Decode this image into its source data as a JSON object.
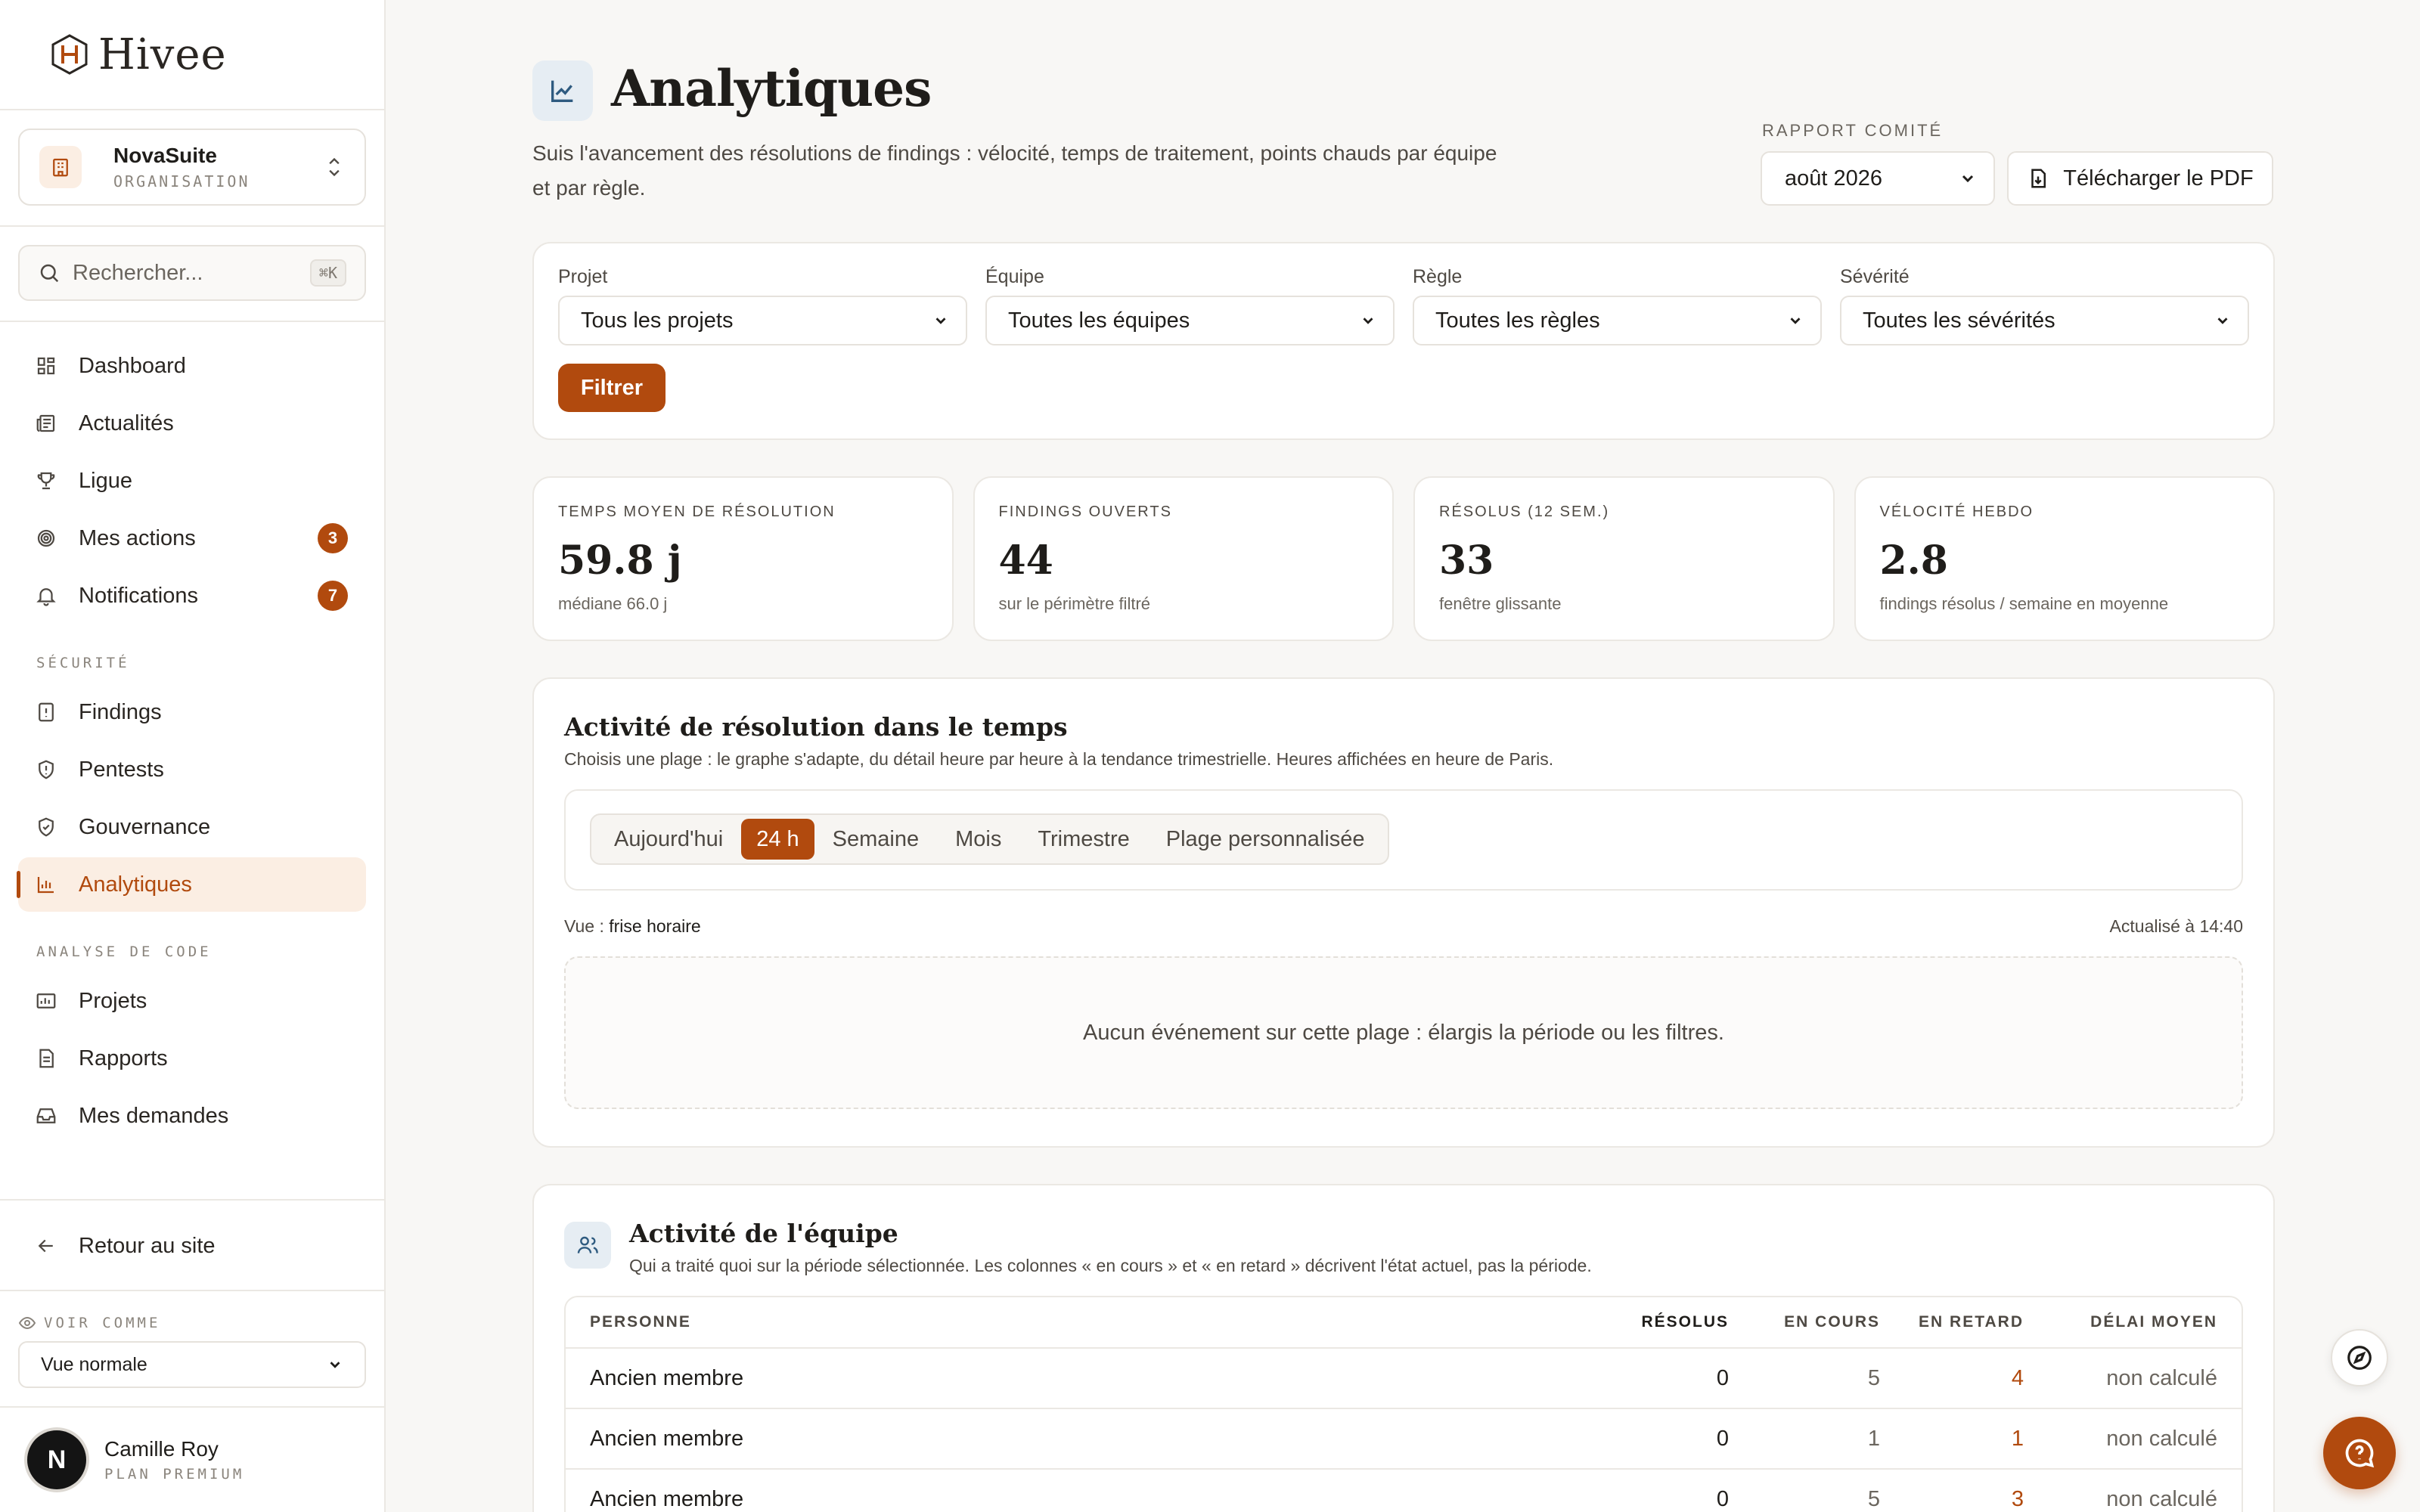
{
  "app": {
    "name": "Hivee"
  },
  "org": {
    "name": "NovaSuite",
    "sub": "ORGANISATION"
  },
  "search": {
    "placeholder": "Rechercher...",
    "shortcut": "⌘K"
  },
  "nav_main": [
    {
      "label": "Dashboard",
      "icon": "dashboard-icon"
    },
    {
      "label": "Actualités",
      "icon": "news-icon"
    },
    {
      "label": "Ligue",
      "icon": "trophy-icon"
    },
    {
      "label": "Mes actions",
      "icon": "target-icon",
      "badge": "3"
    },
    {
      "label": "Notifications",
      "icon": "bell-icon",
      "badge": "7"
    }
  ],
  "sections": {
    "security": "SÉCURITÉ",
    "code": "ANALYSE DE CODE"
  },
  "nav_security": [
    {
      "label": "Findings",
      "icon": "alert-file-icon"
    },
    {
      "label": "Pentests",
      "icon": "shield-alert-icon"
    },
    {
      "label": "Gouvernance",
      "icon": "shield-check-icon"
    },
    {
      "label": "Analytiques",
      "icon": "bar-chart-icon",
      "active": true
    }
  ],
  "nav_code": [
    {
      "label": "Projets",
      "icon": "projects-icon"
    },
    {
      "label": "Rapports",
      "icon": "report-icon"
    },
    {
      "label": "Mes demandes",
      "icon": "inbox-icon"
    }
  ],
  "back": {
    "label": "Retour au site"
  },
  "view_as": {
    "label": "VOIR COMME",
    "value": "Vue normale"
  },
  "user": {
    "name": "Camille Roy",
    "plan": "PLAN PREMIUM",
    "initial": "N"
  },
  "page": {
    "title": "Analytiques",
    "description": "Suis l'avancement des résolutions de findings : vélocité, temps de traitement, points chauds par équipe et par règle."
  },
  "report": {
    "label": "RAPPORT COMITÉ",
    "month": "août 2026",
    "download": "Télécharger le PDF"
  },
  "filters": {
    "project": {
      "label": "Projet",
      "value": "Tous les projets"
    },
    "team": {
      "label": "Équipe",
      "value": "Toutes les équipes"
    },
    "rule": {
      "label": "Règle",
      "value": "Toutes les règles"
    },
    "severity": {
      "label": "Sévérité",
      "value": "Toutes les sévérités"
    },
    "button": "Filtrer"
  },
  "kpis": [
    {
      "label": "TEMPS MOYEN DE RÉSOLUTION",
      "value": "59.8 j",
      "sub": "médiane 66.0 j"
    },
    {
      "label": "FINDINGS OUVERTS",
      "value": "44",
      "sub": "sur le périmètre filtré"
    },
    {
      "label": "RÉSOLUS (12 SEM.)",
      "value": "33",
      "sub": "fenêtre glissante"
    },
    {
      "label": "VÉLOCITÉ HEBDO",
      "value": "2.8",
      "sub": "findings résolus / semaine en moyenne"
    }
  ],
  "activity": {
    "title": "Activité de résolution dans le temps",
    "subtitle": "Choisis une plage : le graphe s'adapte, du détail heure par heure à la tendance trimestrielle. Heures affichées en heure de Paris.",
    "ranges": [
      "Aujourd'hui",
      "24 h",
      "Semaine",
      "Mois",
      "Trimestre",
      "Plage personnalisée"
    ],
    "active_range": "24 h",
    "view_label": "Vue :",
    "view_value": "frise horaire",
    "updated": "Actualisé à 14:40",
    "empty": "Aucun événement sur cette plage : élargis la période ou les filtres."
  },
  "team": {
    "title": "Activité de l'équipe",
    "subtitle": "Qui a traité quoi sur la période sélectionnée. Les colonnes « en cours » et « en retard » décrivent l'état actuel, pas la période.",
    "columns": [
      "PERSONNE",
      "RÉSOLUS",
      "EN COURS",
      "EN RETARD",
      "DÉLAI MOYEN"
    ],
    "rows": [
      {
        "person": "Ancien membre",
        "resolved": "0",
        "in_progress": "5",
        "late": "4",
        "delay": "non calculé"
      },
      {
        "person": "Ancien membre",
        "resolved": "0",
        "in_progress": "1",
        "late": "1",
        "delay": "non calculé"
      },
      {
        "person": "Ancien membre",
        "resolved": "0",
        "in_progress": "5",
        "late": "3",
        "delay": "non calculé"
      }
    ]
  },
  "colors": {
    "accent": "#b14a0e",
    "accent_soft": "#fbeee3",
    "info_soft": "#e6edf3"
  }
}
